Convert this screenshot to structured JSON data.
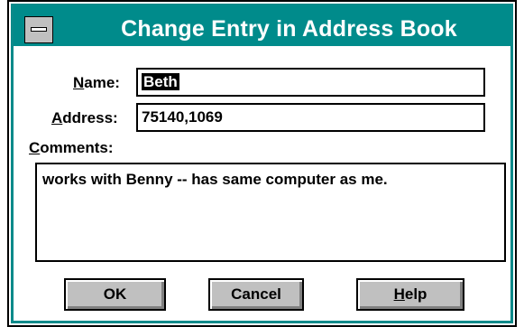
{
  "window": {
    "title": "Change Entry in Address Book",
    "system_menu_icon": "system-menu-icon"
  },
  "form": {
    "name_label_accel": "N",
    "name_label_rest": "ame:",
    "name_value": "Beth",
    "address_label_accel": "A",
    "address_label_rest": "ddress:",
    "address_value": "75140,1069",
    "comments_label_accel": "C",
    "comments_label_rest": "omments:",
    "comments_value": "works with Benny -- has same computer as me."
  },
  "buttons": {
    "ok": "OK",
    "cancel": "Cancel",
    "help_accel": "H",
    "help_rest": "elp"
  },
  "colors": {
    "titlebar": "#008b8b",
    "button_face": "#c0c0c0"
  }
}
